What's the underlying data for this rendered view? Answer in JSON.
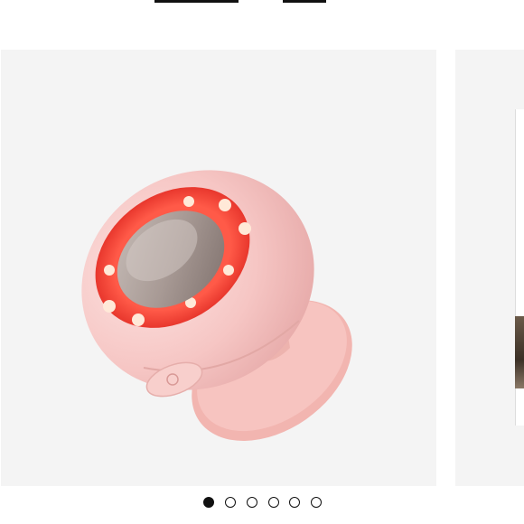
{
  "top_tabs": [
    {
      "name": "tab-indicator-1"
    },
    {
      "name": "tab-indicator-2"
    }
  ],
  "carousel": {
    "active_index": 0,
    "total": 6,
    "dot_labels": [
      "1",
      "2",
      "3",
      "4",
      "5",
      "6"
    ]
  },
  "product_image": {
    "icon": "pink-led-facial-device",
    "colors": {
      "body": "#f7c7c7",
      "led": "#ff4b3e",
      "plate": "#9b8e8a",
      "background": "#f4f4f4"
    }
  }
}
